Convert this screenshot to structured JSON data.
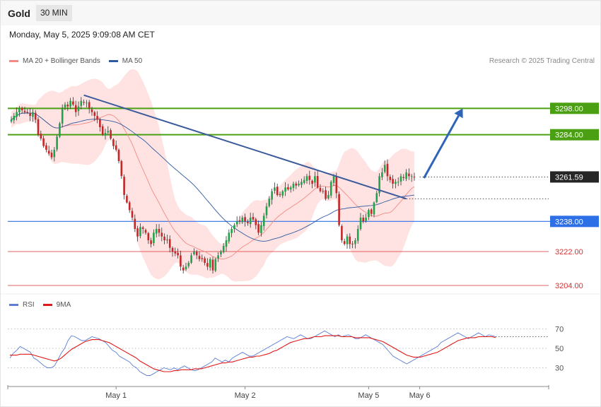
{
  "header": {
    "title": "Gold",
    "timeframe": "30 MIN",
    "timestamp": "Monday, May 5, 2025 9:09:08 AM CET"
  },
  "legend": {
    "price": [
      {
        "label": "MA 20 + Bollinger Bands",
        "color": "#f48a82"
      },
      {
        "label": "MA 50",
        "color": "#2e5a9e"
      }
    ],
    "rsi": [
      {
        "label": "RSI",
        "color": "#5b7fd6"
      },
      {
        "label": "9MA",
        "color": "#e01818"
      }
    ]
  },
  "credit": "Research © 2025 Trading Central",
  "chart_data": [
    {
      "type": "candlestick",
      "ylim": [
        3204,
        3312
      ],
      "current_price": "3261.59",
      "current_value": 3261.59,
      "x_ticks": [
        {
          "label": "May 1",
          "index": 39
        },
        {
          "label": "May 2",
          "index": 87
        },
        {
          "label": "May 5",
          "index": 133
        },
        {
          "label": "May 6",
          "index": 152
        }
      ],
      "levels": [
        {
          "label": "3298.00",
          "value": 3298,
          "color": "#4aa012",
          "style": "badge"
        },
        {
          "label": "3284.00",
          "value": 3284,
          "color": "#4aa012",
          "style": "badge"
        },
        {
          "label": "3238.00",
          "value": 3238,
          "color": "#2d6fe6",
          "style": "badge"
        },
        {
          "label": "3222.00",
          "value": 3222,
          "color": "#d83030",
          "style": "text"
        },
        {
          "label": "3204.00",
          "value": 3204,
          "color": "#d83030",
          "style": "text"
        }
      ],
      "trendline": [
        {
          "i": 27,
          "v": 3305
        },
        {
          "i": 147,
          "v": 3250
        }
      ],
      "forecast_arrow": [
        {
          "i": 152,
          "v": 3261
        },
        {
          "i": 168,
          "v": 3298
        }
      ],
      "dotted_refs": [
        {
          "from": 152,
          "v": 3261.59
        },
        {
          "from": 146,
          "v": 3250
        }
      ],
      "closes": [
        3292,
        3294,
        3296,
        3298,
        3297,
        3296,
        3296,
        3294,
        3296,
        3292,
        3284,
        3282,
        3278,
        3276,
        3274,
        3272,
        3276,
        3283,
        3290,
        3298,
        3300,
        3299,
        3302,
        3300,
        3296,
        3299,
        3302,
        3301,
        3301,
        3298,
        3296,
        3294,
        3292,
        3288,
        3284,
        3285,
        3286,
        3282,
        3278,
        3276,
        3270,
        3262,
        3252,
        3248,
        3244,
        3240,
        3234,
        3230,
        3235,
        3234,
        3232,
        3228,
        3226,
        3232,
        3234,
        3232,
        3230,
        3228,
        3228,
        3224,
        3222,
        3221,
        3220,
        3214,
        3212,
        3214,
        3216,
        3220,
        3222,
        3220,
        3218,
        3218,
        3216,
        3214,
        3218,
        3212,
        3218,
        3220,
        3222,
        3225,
        3228,
        3232,
        3234,
        3236,
        3238,
        3238,
        3240,
        3238,
        3237,
        3240,
        3239,
        3236,
        3232,
        3236,
        3241,
        3246,
        3250,
        3254,
        3256,
        3252,
        3252,
        3254,
        3256,
        3255,
        3256,
        3258,
        3257,
        3258,
        3259,
        3260,
        3262,
        3260,
        3258,
        3262,
        3256,
        3254,
        3254,
        3250,
        3252,
        3259,
        3262,
        3253,
        3236,
        3228,
        3226,
        3230,
        3226,
        3226,
        3228,
        3234,
        3240,
        3238,
        3240,
        3244,
        3242,
        3248,
        3253,
        3262,
        3264,
        3268,
        3262,
        3260,
        3258,
        3259,
        3259,
        3262,
        3261,
        3264,
        3262,
        3262,
        3261.59
      ]
    },
    {
      "type": "line",
      "ylim": [
        18,
        82
      ],
      "y_ticks": [
        {
          "label": "70",
          "value": 70
        },
        {
          "label": "50",
          "value": 50
        },
        {
          "label": "30",
          "value": 30
        }
      ],
      "series": [
        {
          "name": "RSI",
          "values": [
            40,
            45,
            48,
            52,
            50,
            48,
            46,
            40,
            38,
            35,
            32,
            30,
            30,
            32,
            38,
            45,
            50,
            58,
            63,
            62,
            60,
            58,
            58,
            60,
            62,
            61,
            60,
            58,
            56,
            52,
            48,
            46,
            42,
            40,
            38,
            36,
            32,
            30,
            26,
            24,
            22,
            22,
            24,
            26,
            28,
            30,
            29,
            28,
            30,
            28,
            30,
            32,
            30,
            28,
            27,
            28,
            30,
            32,
            34,
            36,
            40,
            38,
            36,
            38,
            36,
            40,
            42,
            44,
            46,
            44,
            42,
            42,
            44,
            46,
            48,
            50,
            52,
            54,
            56,
            58,
            60,
            62,
            61,
            60,
            62,
            64,
            62,
            60,
            60,
            62,
            64,
            66,
            68,
            66,
            64,
            62,
            64,
            62,
            63,
            64,
            62,
            60,
            60,
            62,
            64,
            62,
            60,
            58,
            56,
            54,
            50,
            46,
            42,
            40,
            38,
            36,
            34,
            36,
            38,
            40,
            42,
            44,
            46,
            48,
            50,
            52,
            56,
            58,
            60,
            62,
            64,
            66,
            64,
            62,
            60,
            62,
            64,
            66,
            64,
            62,
            64,
            63,
            62
          ]
        },
        {
          "name": "9MA",
          "values": [
            43,
            43,
            43,
            44,
            44,
            44,
            44,
            43,
            42,
            41,
            40,
            39,
            38,
            37,
            38,
            40,
            43,
            46,
            49,
            51,
            53,
            55,
            57,
            58,
            59,
            59,
            59,
            58,
            57,
            56,
            54,
            52,
            50,
            48,
            46,
            44,
            42,
            40,
            37,
            35,
            33,
            31,
            29,
            28,
            27,
            26,
            26,
            26,
            27,
            27,
            28,
            28,
            28,
            28,
            29,
            29,
            29,
            30,
            31,
            32,
            33,
            34,
            35,
            35,
            36,
            36,
            37,
            38,
            39,
            40,
            41,
            41,
            42,
            42,
            43,
            44,
            45,
            47,
            48,
            50,
            52,
            54,
            56,
            57,
            58,
            59,
            60,
            60,
            61,
            62,
            62,
            62,
            63,
            63,
            63,
            63,
            63,
            62,
            62,
            62,
            62,
            61,
            61,
            61,
            61,
            61,
            60,
            59,
            58,
            57,
            55,
            53,
            51,
            49,
            47,
            45,
            43,
            42,
            41,
            41,
            41,
            42,
            43,
            44,
            45,
            46,
            48,
            50,
            52,
            54,
            56,
            58,
            59,
            60,
            61,
            61,
            61,
            62,
            62,
            62,
            62,
            62,
            61
          ]
        }
      ]
    }
  ]
}
